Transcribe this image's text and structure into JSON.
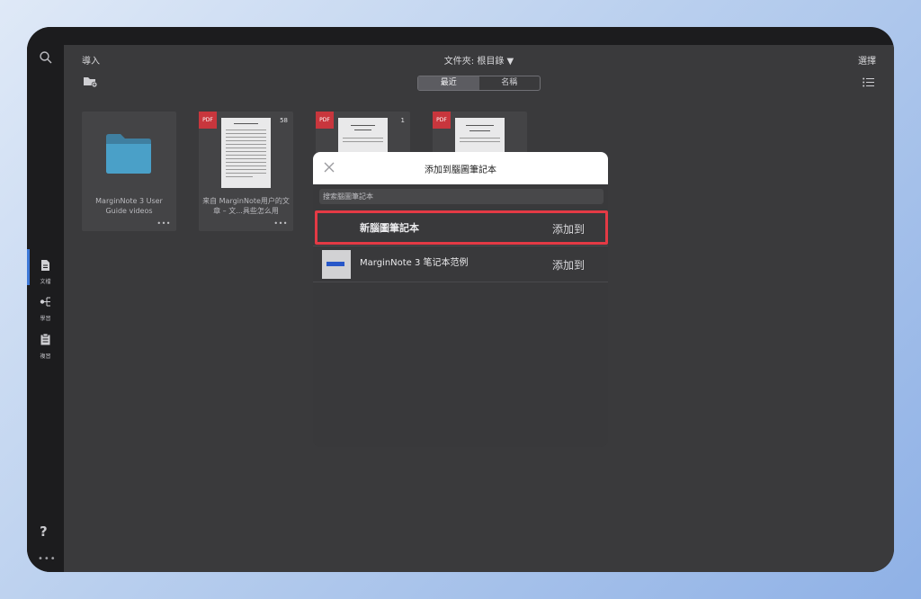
{
  "sidebar": {
    "items": [
      {
        "label": "文檔",
        "icon": "document-icon"
      },
      {
        "label": "學習",
        "icon": "mindmap-icon"
      },
      {
        "label": "複習",
        "icon": "review-clipboard-icon"
      }
    ],
    "help": "?",
    "more": "•••"
  },
  "toolbar": {
    "import_label": "導入",
    "folder_label": "文件夾: 根目錄 ▼",
    "select_label": "選擇"
  },
  "sort": {
    "recent": "最近",
    "name": "名稱"
  },
  "documents": [
    {
      "type": "folder",
      "caption": "MarginNote 3 User Guide videos"
    },
    {
      "type": "pdf",
      "tag": "PDF",
      "count": "58",
      "caption": "来自 MarginNote用户的文章 – 文...具些怎么用"
    },
    {
      "type": "pdf",
      "tag": "PDF",
      "count": "1",
      "caption": ""
    },
    {
      "type": "pdf",
      "tag": "PDF",
      "count": "",
      "caption": ""
    }
  ],
  "dialog": {
    "title": "添加到腦圖筆記本",
    "search_placeholder": "搜索腦圖筆記本",
    "rows": [
      {
        "name": "新腦圖筆記本",
        "action": "添加到"
      },
      {
        "name": "MarginNote 3 笔记本范例",
        "action": "添加到"
      }
    ]
  },
  "colors": {
    "highlight": "#e43a45",
    "accent": "#3d78d8",
    "pdf_tag": "#c8363d",
    "folder": "#4aa0c8"
  }
}
